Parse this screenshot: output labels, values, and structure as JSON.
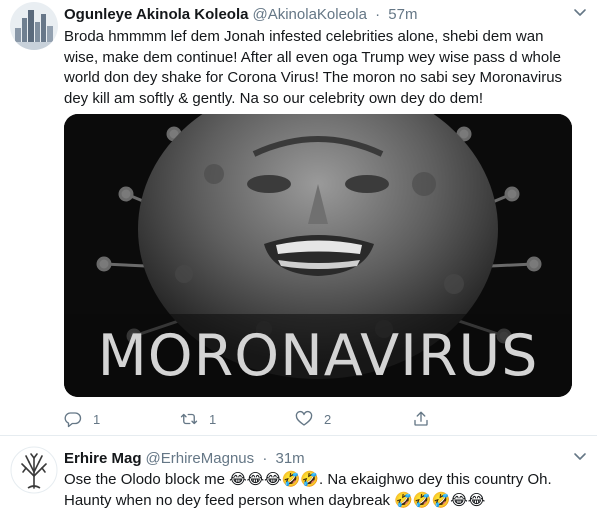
{
  "tweets": [
    {
      "display_name": "Ogunleye Akinola Koleola",
      "handle": "@AkinolaKoleola",
      "separator": "·",
      "time": "57m",
      "text": "Broda hmmmm lef dem Jonah infested celebrities alone, shebi dem wan wise, make dem continue! After all even oga Trump wey wise pass d whole world don dey shake for Corona Virus! The moron no sabi sey Moronavirus dey kill am softly & gently. Na so our celebrity own dey do dem!",
      "media_caption": "MORONAVIRUS",
      "reply_count": "1",
      "retweet_count": "1",
      "like_count": "2"
    },
    {
      "display_name": "Erhire Mag",
      "handle": "@ErhireMagnus",
      "separator": "·",
      "time": "31m",
      "text": "Ose the Olodo block me 😂😂😂🤣🤣. Na ekaighwo dey this country Oh. Haunty when no dey feed person when daybreak 🤣🤣🤣😂😂"
    }
  ],
  "icons": {
    "caret": "chevron-down-icon",
    "reply": "reply-icon",
    "retweet": "retweet-icon",
    "like": "heart-icon",
    "share": "share-icon"
  },
  "colors": {
    "text": "#14171a",
    "secondary": "#657786",
    "divider": "#e6ecf0"
  }
}
